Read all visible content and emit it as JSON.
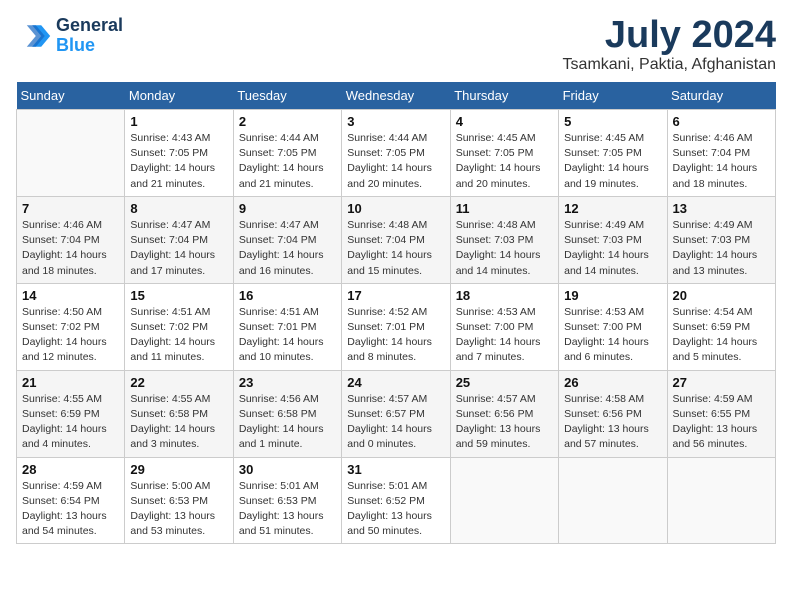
{
  "header": {
    "logo_line1": "General",
    "logo_line2": "Blue",
    "title": "July 2024",
    "subtitle": "Tsamkani, Paktia, Afghanistan"
  },
  "weekdays": [
    "Sunday",
    "Monday",
    "Tuesday",
    "Wednesday",
    "Thursday",
    "Friday",
    "Saturday"
  ],
  "weeks": [
    [
      {
        "num": "",
        "info": ""
      },
      {
        "num": "1",
        "info": "Sunrise: 4:43 AM\nSunset: 7:05 PM\nDaylight: 14 hours\nand 21 minutes."
      },
      {
        "num": "2",
        "info": "Sunrise: 4:44 AM\nSunset: 7:05 PM\nDaylight: 14 hours\nand 21 minutes."
      },
      {
        "num": "3",
        "info": "Sunrise: 4:44 AM\nSunset: 7:05 PM\nDaylight: 14 hours\nand 20 minutes."
      },
      {
        "num": "4",
        "info": "Sunrise: 4:45 AM\nSunset: 7:05 PM\nDaylight: 14 hours\nand 20 minutes."
      },
      {
        "num": "5",
        "info": "Sunrise: 4:45 AM\nSunset: 7:05 PM\nDaylight: 14 hours\nand 19 minutes."
      },
      {
        "num": "6",
        "info": "Sunrise: 4:46 AM\nSunset: 7:04 PM\nDaylight: 14 hours\nand 18 minutes."
      }
    ],
    [
      {
        "num": "7",
        "info": "Sunrise: 4:46 AM\nSunset: 7:04 PM\nDaylight: 14 hours\nand 18 minutes."
      },
      {
        "num": "8",
        "info": "Sunrise: 4:47 AM\nSunset: 7:04 PM\nDaylight: 14 hours\nand 17 minutes."
      },
      {
        "num": "9",
        "info": "Sunrise: 4:47 AM\nSunset: 7:04 PM\nDaylight: 14 hours\nand 16 minutes."
      },
      {
        "num": "10",
        "info": "Sunrise: 4:48 AM\nSunset: 7:04 PM\nDaylight: 14 hours\nand 15 minutes."
      },
      {
        "num": "11",
        "info": "Sunrise: 4:48 AM\nSunset: 7:03 PM\nDaylight: 14 hours\nand 14 minutes."
      },
      {
        "num": "12",
        "info": "Sunrise: 4:49 AM\nSunset: 7:03 PM\nDaylight: 14 hours\nand 14 minutes."
      },
      {
        "num": "13",
        "info": "Sunrise: 4:49 AM\nSunset: 7:03 PM\nDaylight: 14 hours\nand 13 minutes."
      }
    ],
    [
      {
        "num": "14",
        "info": "Sunrise: 4:50 AM\nSunset: 7:02 PM\nDaylight: 14 hours\nand 12 minutes."
      },
      {
        "num": "15",
        "info": "Sunrise: 4:51 AM\nSunset: 7:02 PM\nDaylight: 14 hours\nand 11 minutes."
      },
      {
        "num": "16",
        "info": "Sunrise: 4:51 AM\nSunset: 7:01 PM\nDaylight: 14 hours\nand 10 minutes."
      },
      {
        "num": "17",
        "info": "Sunrise: 4:52 AM\nSunset: 7:01 PM\nDaylight: 14 hours\nand 8 minutes."
      },
      {
        "num": "18",
        "info": "Sunrise: 4:53 AM\nSunset: 7:00 PM\nDaylight: 14 hours\nand 7 minutes."
      },
      {
        "num": "19",
        "info": "Sunrise: 4:53 AM\nSunset: 7:00 PM\nDaylight: 14 hours\nand 6 minutes."
      },
      {
        "num": "20",
        "info": "Sunrise: 4:54 AM\nSunset: 6:59 PM\nDaylight: 14 hours\nand 5 minutes."
      }
    ],
    [
      {
        "num": "21",
        "info": "Sunrise: 4:55 AM\nSunset: 6:59 PM\nDaylight: 14 hours\nand 4 minutes."
      },
      {
        "num": "22",
        "info": "Sunrise: 4:55 AM\nSunset: 6:58 PM\nDaylight: 14 hours\nand 3 minutes."
      },
      {
        "num": "23",
        "info": "Sunrise: 4:56 AM\nSunset: 6:58 PM\nDaylight: 14 hours\nand 1 minute."
      },
      {
        "num": "24",
        "info": "Sunrise: 4:57 AM\nSunset: 6:57 PM\nDaylight: 14 hours\nand 0 minutes."
      },
      {
        "num": "25",
        "info": "Sunrise: 4:57 AM\nSunset: 6:56 PM\nDaylight: 13 hours\nand 59 minutes."
      },
      {
        "num": "26",
        "info": "Sunrise: 4:58 AM\nSunset: 6:56 PM\nDaylight: 13 hours\nand 57 minutes."
      },
      {
        "num": "27",
        "info": "Sunrise: 4:59 AM\nSunset: 6:55 PM\nDaylight: 13 hours\nand 56 minutes."
      }
    ],
    [
      {
        "num": "28",
        "info": "Sunrise: 4:59 AM\nSunset: 6:54 PM\nDaylight: 13 hours\nand 54 minutes."
      },
      {
        "num": "29",
        "info": "Sunrise: 5:00 AM\nSunset: 6:53 PM\nDaylight: 13 hours\nand 53 minutes."
      },
      {
        "num": "30",
        "info": "Sunrise: 5:01 AM\nSunset: 6:53 PM\nDaylight: 13 hours\nand 51 minutes."
      },
      {
        "num": "31",
        "info": "Sunrise: 5:01 AM\nSunset: 6:52 PM\nDaylight: 13 hours\nand 50 minutes."
      },
      {
        "num": "",
        "info": ""
      },
      {
        "num": "",
        "info": ""
      },
      {
        "num": "",
        "info": ""
      }
    ]
  ]
}
